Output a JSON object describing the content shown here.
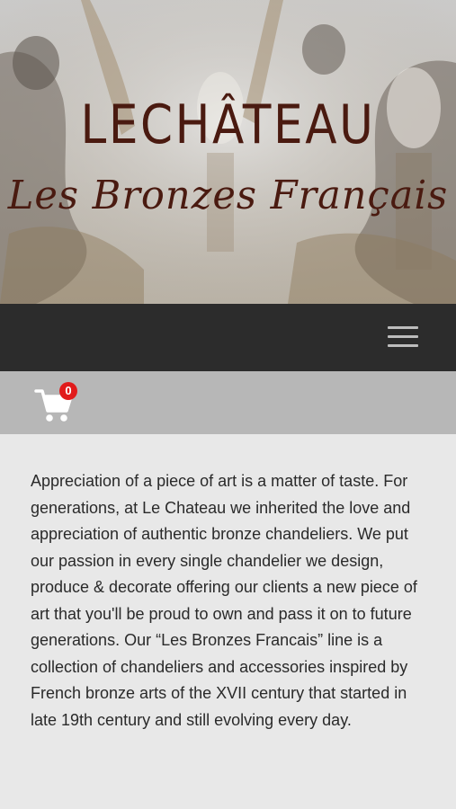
{
  "header": {
    "logo_main": "LECHÂTEAU",
    "logo_sub": "Les Bronzes Français"
  },
  "nav": {
    "menu_icon": "hamburger-menu-icon"
  },
  "cart": {
    "icon": "shopping-cart-icon",
    "count": "0",
    "badge_color": "#e11b1b"
  },
  "content": {
    "intro": "Appreciation of a piece of art is a matter of taste. For generations, at Le Chateau we inherited the love and appreciation of authentic bronze chandeliers. We put our passion in every single chandelier we design, produce & decorate offering our clients a new piece of art that you'll be proud to own and pass it on to future generations. Our “Les Bronzes Francais” line is a collection of chandeliers and accessories inspired by French bronze arts of the XVII century that started in late 19th century and still evolving every day."
  },
  "colors": {
    "brand": "#4a1a10",
    "navbar": "#2c2c2c",
    "cartbar": "#b7b7b7",
    "page": "#e8e8e8"
  }
}
